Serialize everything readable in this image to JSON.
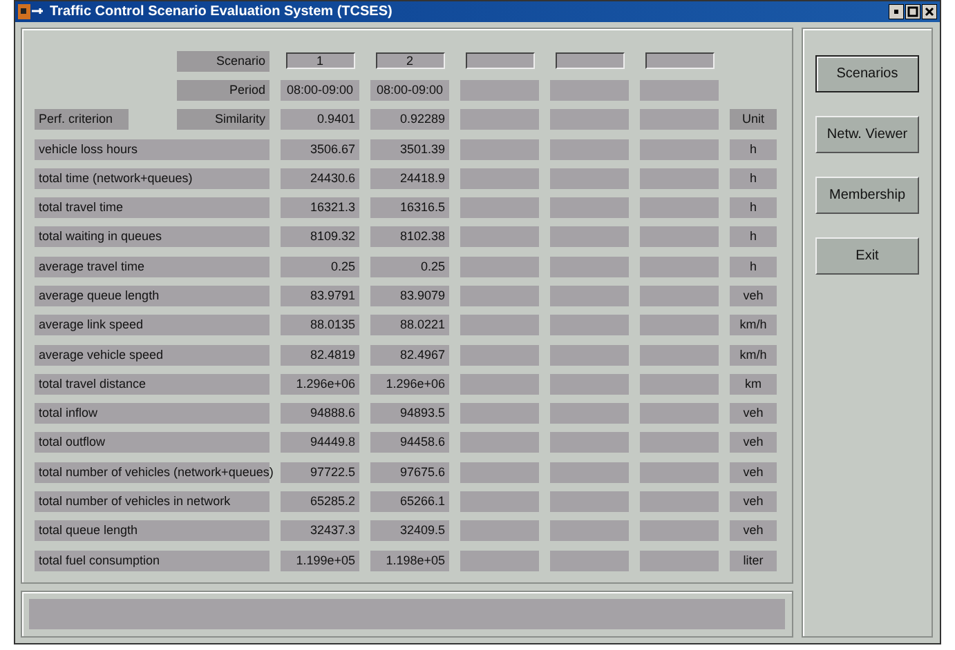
{
  "window": {
    "title": "Traffic Control Scenario Evaluation System (TCSES)"
  },
  "header": {
    "scenario_label": "Scenario",
    "period_label": "Period",
    "criterion_label": "Perf. criterion",
    "similarity_label": "Similarity",
    "unit_label": "Unit"
  },
  "columns": [
    {
      "scenario": "1",
      "period": "08:00-09:00",
      "similarity": "0.9401"
    },
    {
      "scenario": "2",
      "period": "08:00-09:00",
      "similarity": "0.92289"
    },
    {},
    {},
    {}
  ],
  "rows": [
    {
      "label": "vehicle loss hours",
      "values": [
        "3506.67",
        "3501.39"
      ],
      "unit": "h"
    },
    {
      "label": "total time (network+queues)",
      "values": [
        "24430.6",
        "24418.9"
      ],
      "unit": "h"
    },
    {
      "label": "total travel time",
      "values": [
        "16321.3",
        "16316.5"
      ],
      "unit": "h"
    },
    {
      "label": "total waiting in queues",
      "values": [
        "8109.32",
        "8102.38"
      ],
      "unit": "h"
    },
    {
      "label": "average travel time",
      "values": [
        "0.25",
        "0.25"
      ],
      "unit": "h"
    },
    {
      "label": "average queue length",
      "values": [
        "83.9791",
        "83.9079"
      ],
      "unit": "veh"
    },
    {
      "label": "average link speed",
      "values": [
        "88.0135",
        "88.0221"
      ],
      "unit": "km/h"
    },
    {
      "label": "average vehicle speed",
      "values": [
        "82.4819",
        "82.4967"
      ],
      "unit": "km/h"
    },
    {
      "label": "total travel distance",
      "values": [
        "1.296e+06",
        "1.296e+06"
      ],
      "unit": "km"
    },
    {
      "label": "total inflow",
      "values": [
        "94888.6",
        "94893.5"
      ],
      "unit": "veh"
    },
    {
      "label": "total outflow",
      "values": [
        "94449.8",
        "94458.6"
      ],
      "unit": "veh"
    },
    {
      "label": "total number of vehicles (network+queues)",
      "values": [
        "97722.5",
        "97675.6"
      ],
      "unit": "veh"
    },
    {
      "label": "total number of vehicles in network",
      "values": [
        "65285.2",
        "65266.1"
      ],
      "unit": "veh"
    },
    {
      "label": "total queue length",
      "values": [
        "32437.3",
        "32409.5"
      ],
      "unit": "veh"
    },
    {
      "label": "total fuel consumption",
      "values": [
        "1.199e+05",
        "1.198e+05"
      ],
      "unit": "liter"
    }
  ],
  "buttons": [
    {
      "label": "Scenarios",
      "selected": true
    },
    {
      "label": "Netw. Viewer",
      "selected": false
    },
    {
      "label": "Membership",
      "selected": false
    },
    {
      "label": "Exit",
      "selected": false
    }
  ]
}
